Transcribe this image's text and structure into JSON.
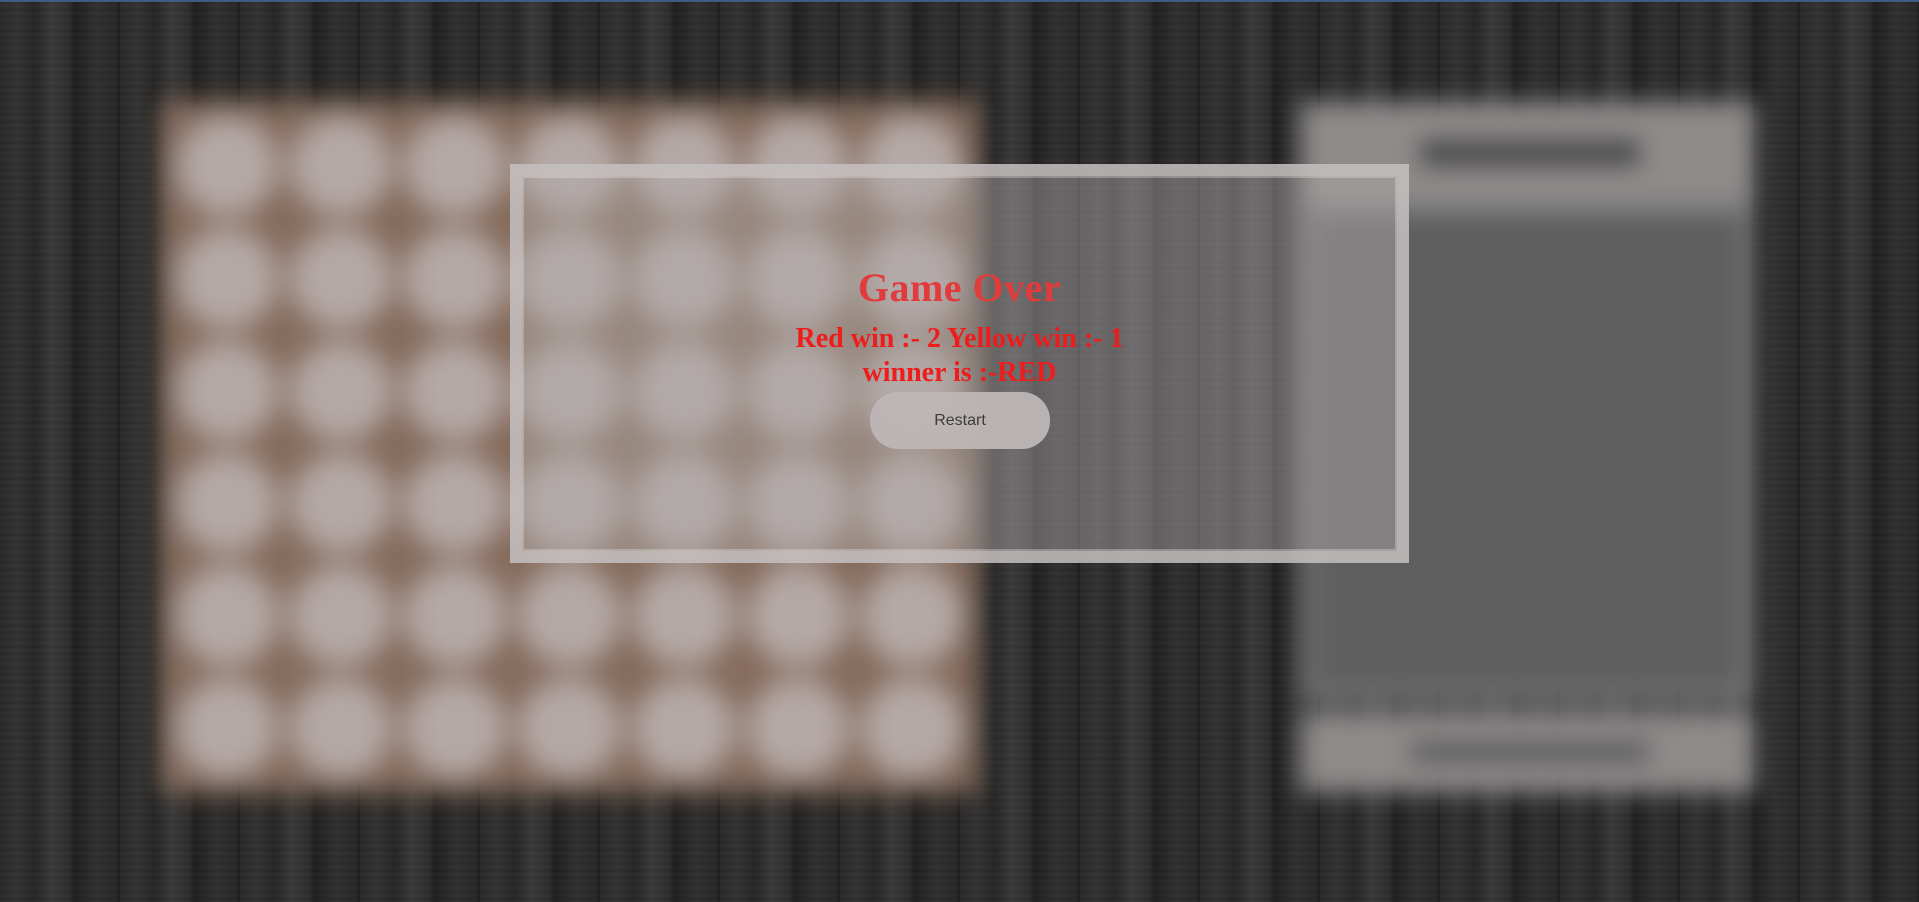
{
  "modal": {
    "title": "Game Over",
    "score_line": "Red win :- 2 Yellow win :- 1",
    "winner_line": "winner is :-RED",
    "restart_label": "Restart"
  },
  "colors": {
    "title": "#e13b3b",
    "score_text": "#ee1c1c",
    "board": "#7a5b46",
    "accent_line": "#3f5c86"
  },
  "board": {
    "rows": 6,
    "columns": 7
  }
}
